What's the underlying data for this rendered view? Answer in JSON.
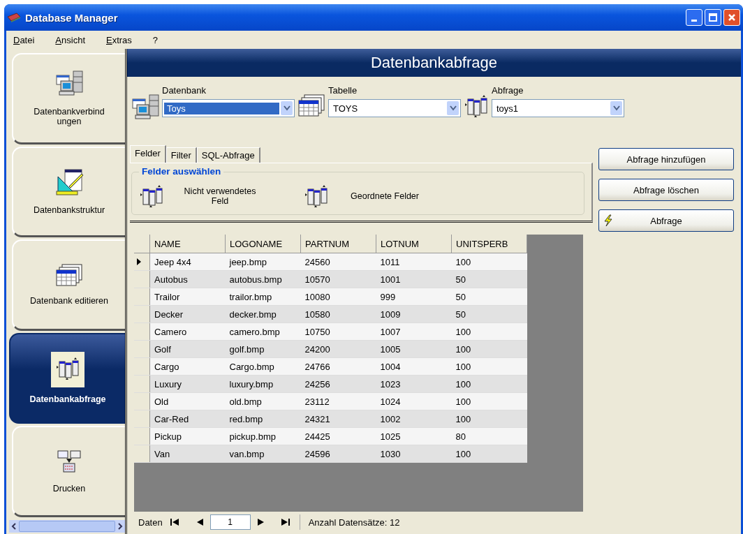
{
  "window": {
    "title": "Database Manager"
  },
  "menu": [
    {
      "mnemonic": "D",
      "rest": "atei"
    },
    {
      "mnemonic": "A",
      "rest": "nsicht"
    },
    {
      "mnemonic": "E",
      "rest": "xtras"
    },
    {
      "rest": "?"
    }
  ],
  "sidebar": {
    "items": [
      {
        "kind": "connection",
        "label": "Datenbankverbind ungen",
        "selected": false
      },
      {
        "kind": "structure",
        "label": "Datenbankstruktur",
        "selected": false
      },
      {
        "kind": "edit",
        "label": "Datenbank editieren",
        "selected": false
      },
      {
        "kind": "query",
        "label": "Datenbankabfrage",
        "selected": true
      },
      {
        "kind": "print",
        "label": "Drucken",
        "selected": false
      }
    ]
  },
  "header": {
    "title": "Datenbankabfrage"
  },
  "selectors": [
    {
      "kind": "connection",
      "label": "Datenbank",
      "value": "Toys",
      "highlighted": true
    },
    {
      "kind": "table",
      "label": "Tabelle",
      "value": "TOYS",
      "highlighted": false
    },
    {
      "kind": "query",
      "label": "Abfrage",
      "value": "toys1",
      "highlighted": false
    }
  ],
  "tabs": [
    {
      "label": "Felder",
      "selected": true
    },
    {
      "label": "Filter",
      "selected": false
    },
    {
      "label": "SQL-Abfrage",
      "selected": false
    }
  ],
  "field_group": {
    "title": "Felder auswählen",
    "items": [
      "Nicht verwendetes Feld",
      "Geordnete Felder"
    ]
  },
  "buttons": [
    {
      "label": "Abfrage hinzufügen",
      "kind": "plain"
    },
    {
      "label": "Abfrage löschen",
      "kind": "plain"
    },
    {
      "label": "Abfrage",
      "kind": "run"
    }
  ],
  "table": {
    "columns": [
      "NAME",
      "LOGONAME",
      "PARTNUM",
      "LOTNUM",
      "UNITSPERB"
    ],
    "rows": [
      {
        "selected": true,
        "cells": [
          "Jeep 4x4",
          "jeep.bmp",
          "24560",
          "1011",
          "100"
        ]
      },
      {
        "selected": false,
        "cells": [
          "Autobus",
          "autobus.bmp",
          "10570",
          "1001",
          "50"
        ]
      },
      {
        "selected": false,
        "cells": [
          "Trailor",
          "trailor.bmp",
          "10080",
          "999",
          "50"
        ]
      },
      {
        "selected": false,
        "cells": [
          "Decker",
          "decker.bmp",
          "10580",
          "1009",
          "50"
        ]
      },
      {
        "selected": false,
        "cells": [
          "Camero",
          "camero.bmp",
          "10750",
          "1007",
          "100"
        ]
      },
      {
        "selected": false,
        "cells": [
          "Golf",
          "golf.bmp",
          "24200",
          "1005",
          "100"
        ]
      },
      {
        "selected": false,
        "cells": [
          "Cargo",
          "Cargo.bmp",
          "24766",
          "1004",
          "100"
        ]
      },
      {
        "selected": false,
        "cells": [
          "Luxury",
          "luxury.bmp",
          "24256",
          "1023",
          "100"
        ]
      },
      {
        "selected": false,
        "cells": [
          "Old",
          "old.bmp",
          "23112",
          "1024",
          "100"
        ]
      },
      {
        "selected": false,
        "cells": [
          "Car-Red",
          "red.bmp",
          "24321",
          "1002",
          "100"
        ]
      },
      {
        "selected": false,
        "cells": [
          "Pickup",
          "pickup.bmp",
          "24425",
          "1025",
          "80"
        ]
      },
      {
        "selected": false,
        "cells": [
          "Van",
          "van.bmp",
          "24596",
          "1030",
          "100"
        ]
      }
    ]
  },
  "navigator": {
    "label": "Daten",
    "record": "1",
    "count": "Anzahl Datensätze: 12"
  }
}
